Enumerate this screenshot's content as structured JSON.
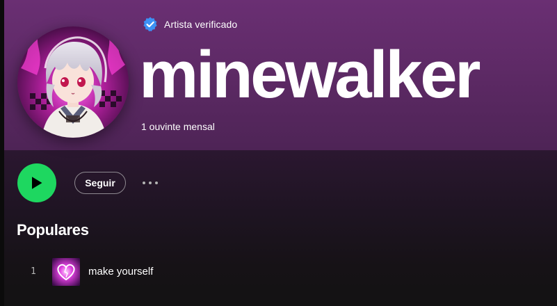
{
  "artist": {
    "verified_label": "Artista verificado",
    "name": "minewalker",
    "monthly_listeners": "1 ouvinte mensal"
  },
  "actions": {
    "play_icon": "play-icon",
    "follow_label": "Seguir",
    "more_icon": "more-options-icon"
  },
  "popular": {
    "title": "Populares",
    "tracks": [
      {
        "index": "1",
        "title": "make yourself"
      }
    ]
  },
  "colors": {
    "accent_green": "#1ed760",
    "verified_blue": "#3d91f4",
    "hero_purple": "#6a2f73",
    "background": "#121212"
  }
}
